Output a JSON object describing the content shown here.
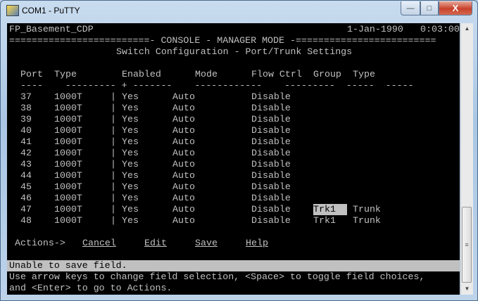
{
  "window": {
    "title": "COM1 - PuTTY",
    "minimize": "—",
    "maximize": "□",
    "close": "X"
  },
  "header": {
    "hostname": "FP_Basement_CDP",
    "date": "1-Jan-1990",
    "time": "0:03:00",
    "banner": "=========================- CONSOLE - MANAGER MODE -=========================",
    "subtitle": "Switch Configuration - Port/Trunk Settings"
  },
  "table": {
    "columns": [
      "Port",
      "Type",
      "Enabled",
      "Mode",
      "Flow Ctrl",
      "Group",
      "Type"
    ],
    "dashes": "----    --------- + -------    ------------    ---------  -----  -----",
    "rows": [
      {
        "port": "37",
        "type": "1000T",
        "enabled": "Yes",
        "mode": "Auto",
        "flow": "Disable",
        "group": "",
        "ttype": ""
      },
      {
        "port": "38",
        "type": "1000T",
        "enabled": "Yes",
        "mode": "Auto",
        "flow": "Disable",
        "group": "",
        "ttype": ""
      },
      {
        "port": "39",
        "type": "1000T",
        "enabled": "Yes",
        "mode": "Auto",
        "flow": "Disable",
        "group": "",
        "ttype": ""
      },
      {
        "port": "40",
        "type": "1000T",
        "enabled": "Yes",
        "mode": "Auto",
        "flow": "Disable",
        "group": "",
        "ttype": ""
      },
      {
        "port": "41",
        "type": "1000T",
        "enabled": "Yes",
        "mode": "Auto",
        "flow": "Disable",
        "group": "",
        "ttype": ""
      },
      {
        "port": "42",
        "type": "1000T",
        "enabled": "Yes",
        "mode": "Auto",
        "flow": "Disable",
        "group": "",
        "ttype": ""
      },
      {
        "port": "43",
        "type": "1000T",
        "enabled": "Yes",
        "mode": "Auto",
        "flow": "Disable",
        "group": "",
        "ttype": ""
      },
      {
        "port": "44",
        "type": "1000T",
        "enabled": "Yes",
        "mode": "Auto",
        "flow": "Disable",
        "group": "",
        "ttype": ""
      },
      {
        "port": "45",
        "type": "1000T",
        "enabled": "Yes",
        "mode": "Auto",
        "flow": "Disable",
        "group": "",
        "ttype": ""
      },
      {
        "port": "46",
        "type": "1000T",
        "enabled": "Yes",
        "mode": "Auto",
        "flow": "Disable",
        "group": "",
        "ttype": ""
      },
      {
        "port": "47",
        "type": "1000T",
        "enabled": "Yes",
        "mode": "Auto",
        "flow": "Disable",
        "group": "Trk1  ",
        "ttype": "Trunk",
        "selected": true
      },
      {
        "port": "48",
        "type": "1000T",
        "enabled": "Yes",
        "mode": "Auto",
        "flow": "Disable",
        "group": "Trk1",
        "ttype": "Trunk"
      }
    ]
  },
  "actions": {
    "label": "Actions->",
    "items": [
      "Cancel",
      "Edit",
      "Save",
      "Help"
    ]
  },
  "status": {
    "message": "Unable to save field.",
    "help1": "Use arrow keys to change field selection, <Space> to toggle field choices,",
    "help2": "and <Enter> to go to Actions."
  }
}
